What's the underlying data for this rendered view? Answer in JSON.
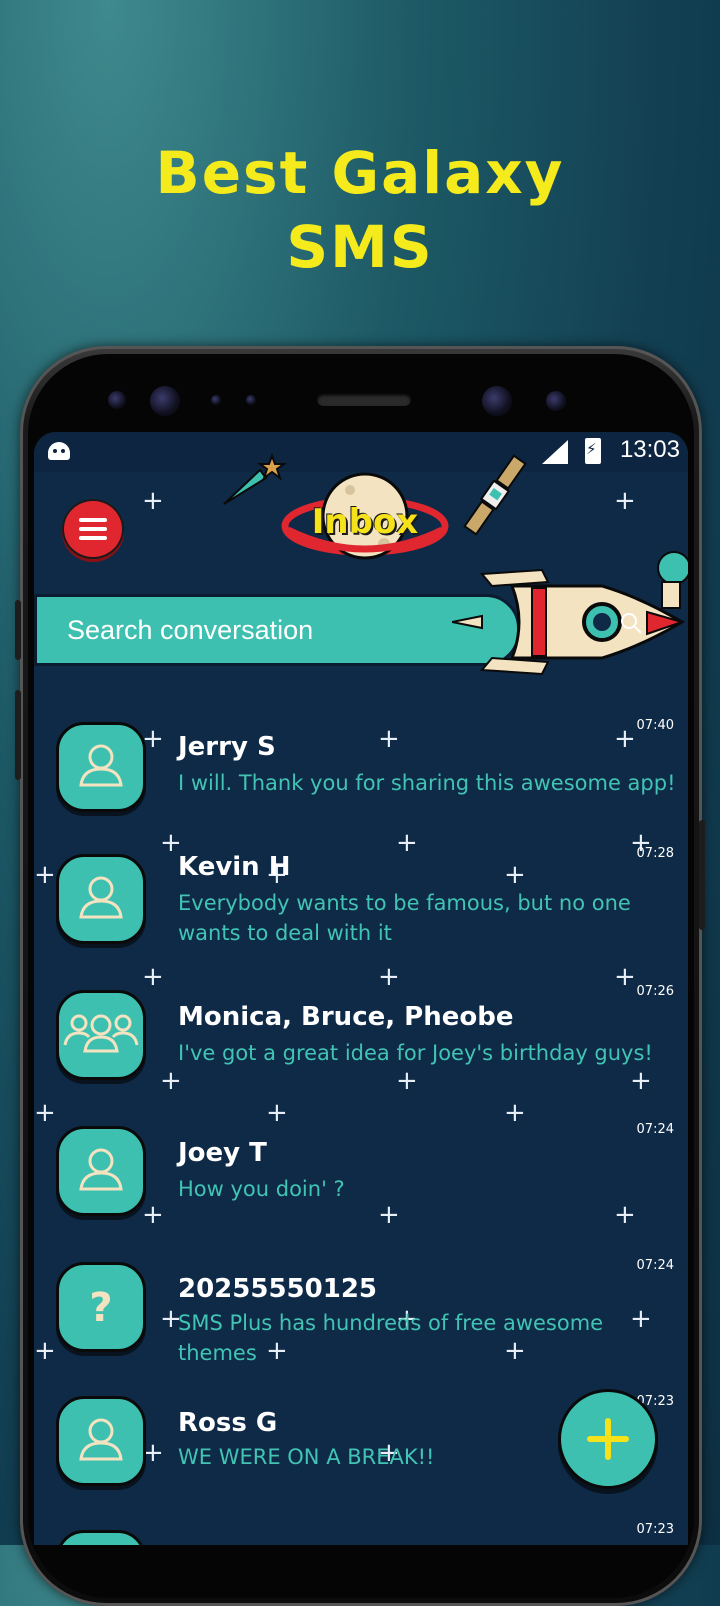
{
  "promo": {
    "line1": "Best Galaxy",
    "line2": "SMS"
  },
  "statusbar": {
    "time": "13:03"
  },
  "header": {
    "title": "Inbox"
  },
  "search": {
    "placeholder": "Search conversation"
  },
  "conversations": [
    {
      "name": "Jerry S",
      "snippet": "I will. Thank you for sharing this awesome app!",
      "time": "07:40",
      "avatar": "person-icon"
    },
    {
      "name": "Kevin H",
      "snippet": "Everybody wants to be famous, but no one wants to deal with it",
      "time": "07:28",
      "avatar": "person-icon"
    },
    {
      "name": "Monica, Bruce, Pheobe",
      "snippet": "I've got a great idea for Joey's birthday guys!",
      "time": "07:26",
      "avatar": "group-icon"
    },
    {
      "name": "Joey T",
      "snippet": "How you doin' ?",
      "time": "07:24",
      "avatar": "person-icon"
    },
    {
      "name": "20255550125",
      "snippet": "SMS Plus has hundreds of free awesome themes",
      "time": "07:24",
      "avatar": "unknown-icon"
    },
    {
      "name": "Ross G",
      "snippet": "WE WERE ON A BREAK!!",
      "time": "07:23",
      "avatar": "person-icon"
    },
    {
      "name": "",
      "snippet": "",
      "time": "07:23",
      "avatar": "person-icon"
    }
  ],
  "colors": {
    "accent": "#3dc0b0",
    "title_yellow": "#f4ea1c",
    "background": "#0f2a47",
    "menu_red": "#e0262f"
  }
}
